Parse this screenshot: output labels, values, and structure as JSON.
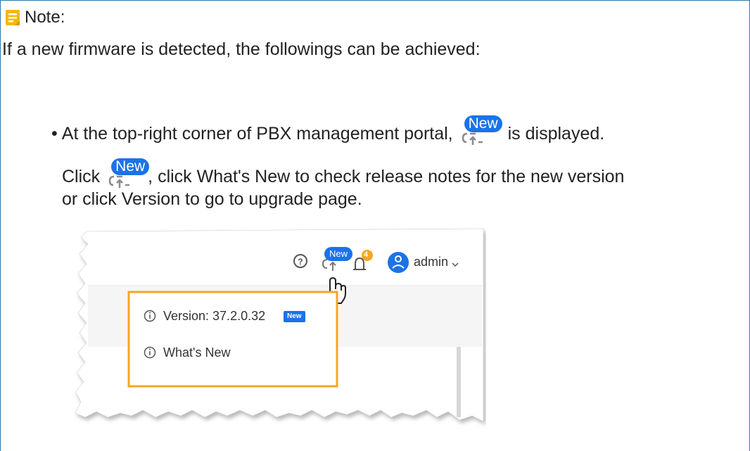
{
  "note": {
    "title": "Note:",
    "intro": "If a new firmware is detected, the followings can be achieved:",
    "bullet_symbol": "•",
    "bullet_before_icon": "At the top-right corner of PBX management portal,",
    "bullet_after_icon": "is displayed.",
    "line2_before_icon": "Click",
    "line2_after_icon": ", click What's New to check release notes for the new version",
    "line3": "or click Version to go to upgrade page.",
    "new_badge_label": "New"
  },
  "screenshot": {
    "badge_label": "New",
    "notification_count": "4",
    "user_name": "admin",
    "dropdown": [
      {
        "label": "Version: 37.2.0.32",
        "tag": "New"
      },
      {
        "label": "What's New",
        "tag": ""
      }
    ]
  },
  "colors": {
    "border": "#2e77a8",
    "note_icon": "#f5b800",
    "brand_blue": "#1a73e8",
    "highlight_box": "#f5a623",
    "notification_badge": "#f5a623"
  },
  "icons": {
    "note": "note-icon",
    "cloud_upgrade": "cloud-upgrade-icon",
    "help": "help-icon",
    "bell": "bell-icon",
    "avatar": "user-avatar-icon",
    "info": "info-icon",
    "hand": "hand-pointer-icon",
    "caret": "chevron-down-icon"
  }
}
